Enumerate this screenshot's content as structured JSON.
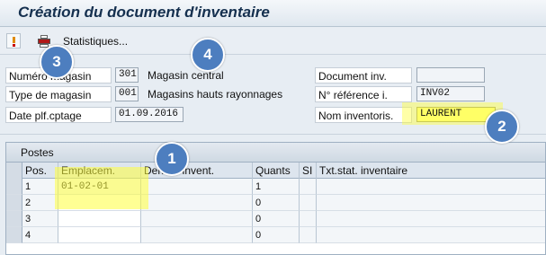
{
  "window": {
    "title": "Création du document d'inventaire"
  },
  "toolbar": {
    "execute_icon": "execute-icon",
    "print_icon": "print-icon",
    "statistics_label": "Statistiques..."
  },
  "header": {
    "numero_magasin": {
      "label": "Numéro magasin",
      "value": "301",
      "desc": "Magasin central"
    },
    "type_magasin": {
      "label": "Type de magasin",
      "value": "001",
      "desc": "Magasins hauts rayonnages"
    },
    "date_plf": {
      "label": "Date plf.cptage",
      "value": "01.09.2016"
    },
    "document_inv": {
      "label": "Document inv.",
      "value": ""
    },
    "no_reference": {
      "label": "N° référence i.",
      "value": "INV02"
    },
    "nom_inventoris": {
      "label": "Nom inventoris.",
      "value": "LAURENT"
    }
  },
  "table": {
    "title": "Postes",
    "columns": [
      "Pos.",
      "Emplacem.",
      "Dernier invent.",
      "Quants",
      "SI",
      "Txt.stat. inventaire"
    ],
    "rows": [
      {
        "pos": "1",
        "emplacement": "01-02-01",
        "dernier": "",
        "quants": "1",
        "si": "",
        "txt": ""
      },
      {
        "pos": "2",
        "emplacement": "",
        "dernier": "",
        "quants": "0",
        "si": "",
        "txt": ""
      },
      {
        "pos": "3",
        "emplacement": "",
        "dernier": "",
        "quants": "0",
        "si": "",
        "txt": ""
      },
      {
        "pos": "4",
        "emplacement": "",
        "dernier": "",
        "quants": "0",
        "si": "",
        "txt": ""
      }
    ]
  },
  "badges": [
    "1",
    "2",
    "3",
    "4"
  ],
  "colors": {
    "highlight": "#ffff66",
    "badge": "#4d7ebf",
    "title": "#15304f"
  }
}
